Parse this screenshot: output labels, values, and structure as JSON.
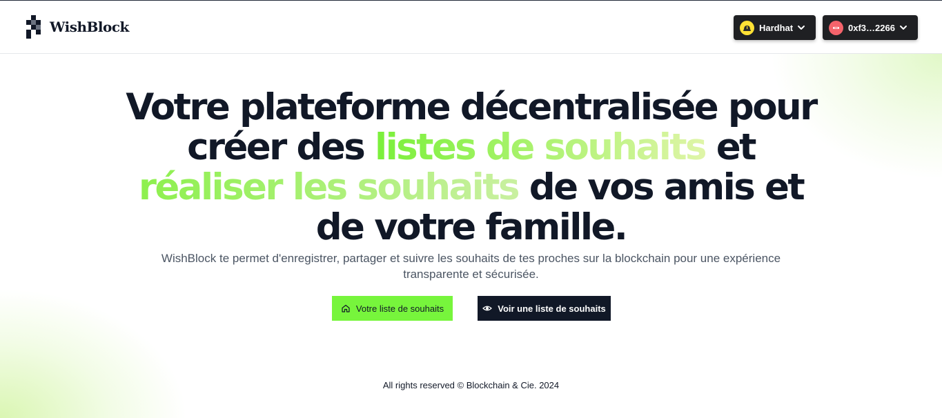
{
  "header": {
    "logo_text": "WishBlock",
    "network": {
      "label": "Hardhat",
      "icon": "hardhat-icon"
    },
    "account": {
      "label": "0xf3…2266",
      "icon": "account-avatar-icon"
    }
  },
  "hero": {
    "title_part1": "Votre plateforme décentralisée pour créer des ",
    "title_highlight1": "listes de souhaits",
    "title_part2": " et ",
    "title_highlight2": "réaliser les souhaits",
    "title_part3": " de vos amis et de votre famille.",
    "subtitle": "WishBlock te permet d'enregistrer, partager et suivre les souhaits de tes proches sur la blockchain pour une expérience transparente et sécurisée."
  },
  "actions": {
    "my_list_label": "Votre liste de souhaits",
    "my_list_icon": "home-icon",
    "view_list_label": "Voir une liste de souhaits",
    "view_list_icon": "eye-icon"
  },
  "footer": {
    "text": "All rights reserved © Blockchain & Cie. 2024"
  },
  "colors": {
    "accent_green": "#77f53c",
    "dark": "#111827",
    "pill_bg": "#1f2023"
  }
}
